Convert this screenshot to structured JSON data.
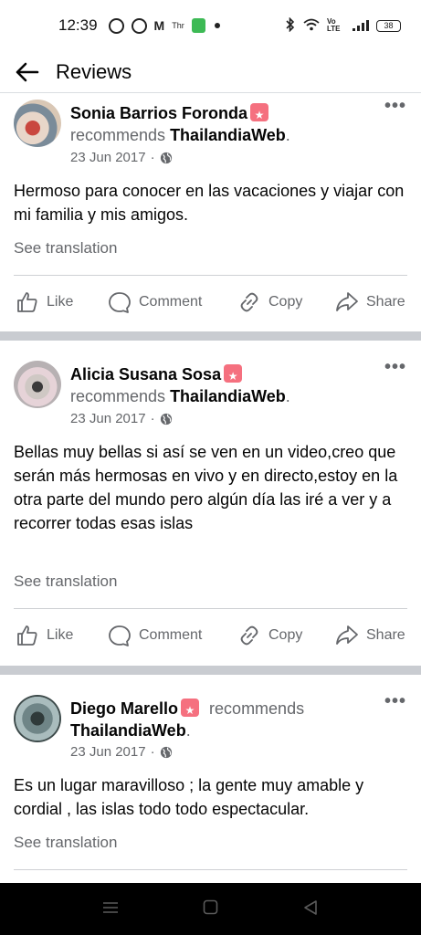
{
  "status_bar": {
    "time": "12:39",
    "mail_icon": "M",
    "tiny_label": "Thr",
    "net_label": "Vo LTE",
    "battery": "38"
  },
  "header": {
    "title": "Reviews"
  },
  "actions": {
    "like": "Like",
    "comment": "Comment",
    "copy": "Copy",
    "share": "Share"
  },
  "reviews": [
    {
      "author": "Sonia Barrios Foronda",
      "verb": "recommends",
      "page": "ThailandiaWeb",
      "date": "23 Jun 2017",
      "text": "Hermoso para conocer en las vacaciones y viajar con mi familia y mis amigos.",
      "see_translation": "See translation"
    },
    {
      "author": "Alicia Susana Sosa",
      "verb": "recommends",
      "page": "ThailandiaWeb",
      "date": "23 Jun 2017",
      "text": "Bellas muy bellas si así se ven en un video,creo que serán más hermosas en vivo y en directo,estoy en la otra parte del mundo pero algún día las iré a ver y a recorrer todas esas islas",
      "see_translation": "See translation"
    },
    {
      "author": "Diego Marello",
      "verb": "recommends",
      "page": "ThailandiaWeb",
      "date": "23 Jun 2017",
      "text": "Es un lugar maravilloso ; la gente muy amable y cordial , las islas todo todo espectacular.",
      "see_translation": "See translation"
    }
  ],
  "colors": {
    "secondary_text": "#65676b",
    "badge": "#f5707f",
    "separator": "#c9ccd1"
  }
}
